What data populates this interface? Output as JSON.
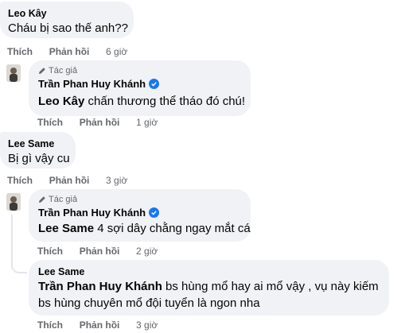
{
  "comments": [
    {
      "name": "Leo Kây",
      "text": "Cháu bị sao thế anh??",
      "like": "Thích",
      "reply": "Phản hồi",
      "time": "6 giờ"
    },
    {
      "author_badge": "Tác giả",
      "name": "Trần Phan Huy Khánh",
      "tag": "Leo Kây",
      "text": "chấn thương thể tháo đó chú!",
      "like": "Thích",
      "reply": "Phản hồi",
      "time": "1 giờ"
    },
    {
      "name": "Lee Same",
      "text": "Bị gì vậy cu",
      "like": "Thích",
      "reply": "Phản hồi",
      "time": "3 giờ"
    },
    {
      "author_badge": "Tác giả",
      "name": "Trần Phan Huy Khánh",
      "tag": "Lee Same",
      "text": "4 sợi dây chằng ngay mắt cá",
      "like": "Thích",
      "reply": "Phản hồi",
      "time": "2 giờ"
    },
    {
      "name": "Lee Same",
      "tag": "Trần Phan Huy Khánh",
      "text_line1": "bs hùng mổ hay ai mổ vậy , vụ này kiếm",
      "text_line2": "bs hùng chuyên mổ đội tuyển là ngon nha",
      "like": "Thích",
      "reply": "Phản hồi",
      "time": "3 giờ"
    }
  ],
  "colors": {
    "bubble": "#f0f2f5",
    "meta": "#65676b",
    "verified": "#1877f2"
  },
  "icons": [
    "pencil-icon",
    "verified-badge-icon",
    "avatar-photo"
  ]
}
